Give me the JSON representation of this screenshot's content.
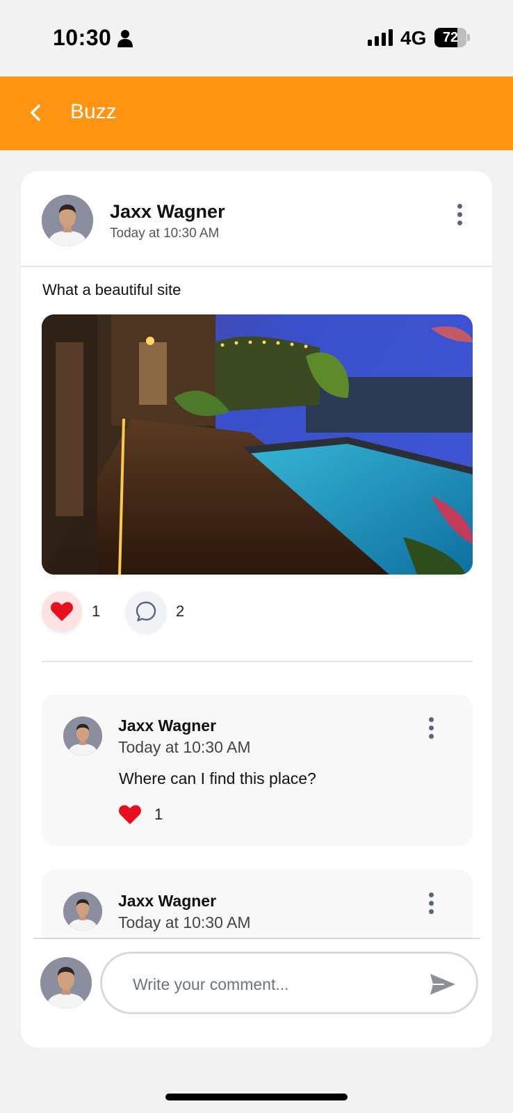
{
  "status_bar": {
    "time": "10:30",
    "network": "4G",
    "battery": "72",
    "battery_level": 0.72,
    "icons": [
      "person-icon",
      "signal-icon",
      "battery-icon"
    ]
  },
  "header": {
    "title": "Buzz",
    "back_icon": "chevron-left-icon",
    "background": "#ff9512"
  },
  "post": {
    "author": "Jaxx Wagner",
    "time": "Today at 10:30 AM",
    "text": "What a beautiful site",
    "likes": "1",
    "comments": "2",
    "icons": [
      "avatar",
      "more-vertical-icon",
      "heart-icon",
      "chat-bubble-icon"
    ]
  },
  "comments": [
    {
      "author": "Jaxx Wagner",
      "time": "Today at 10:30 AM",
      "text": "Where can I find this place?",
      "likes": "1"
    },
    {
      "author": "Jaxx Wagner",
      "time": "Today at 10:30 AM"
    }
  ],
  "composer": {
    "placeholder": "Write your comment...",
    "send_icon": "send-icon"
  },
  "colors": {
    "accent": "#ff9512",
    "like": "#e8101f",
    "icon_gray": "#5b6478"
  }
}
